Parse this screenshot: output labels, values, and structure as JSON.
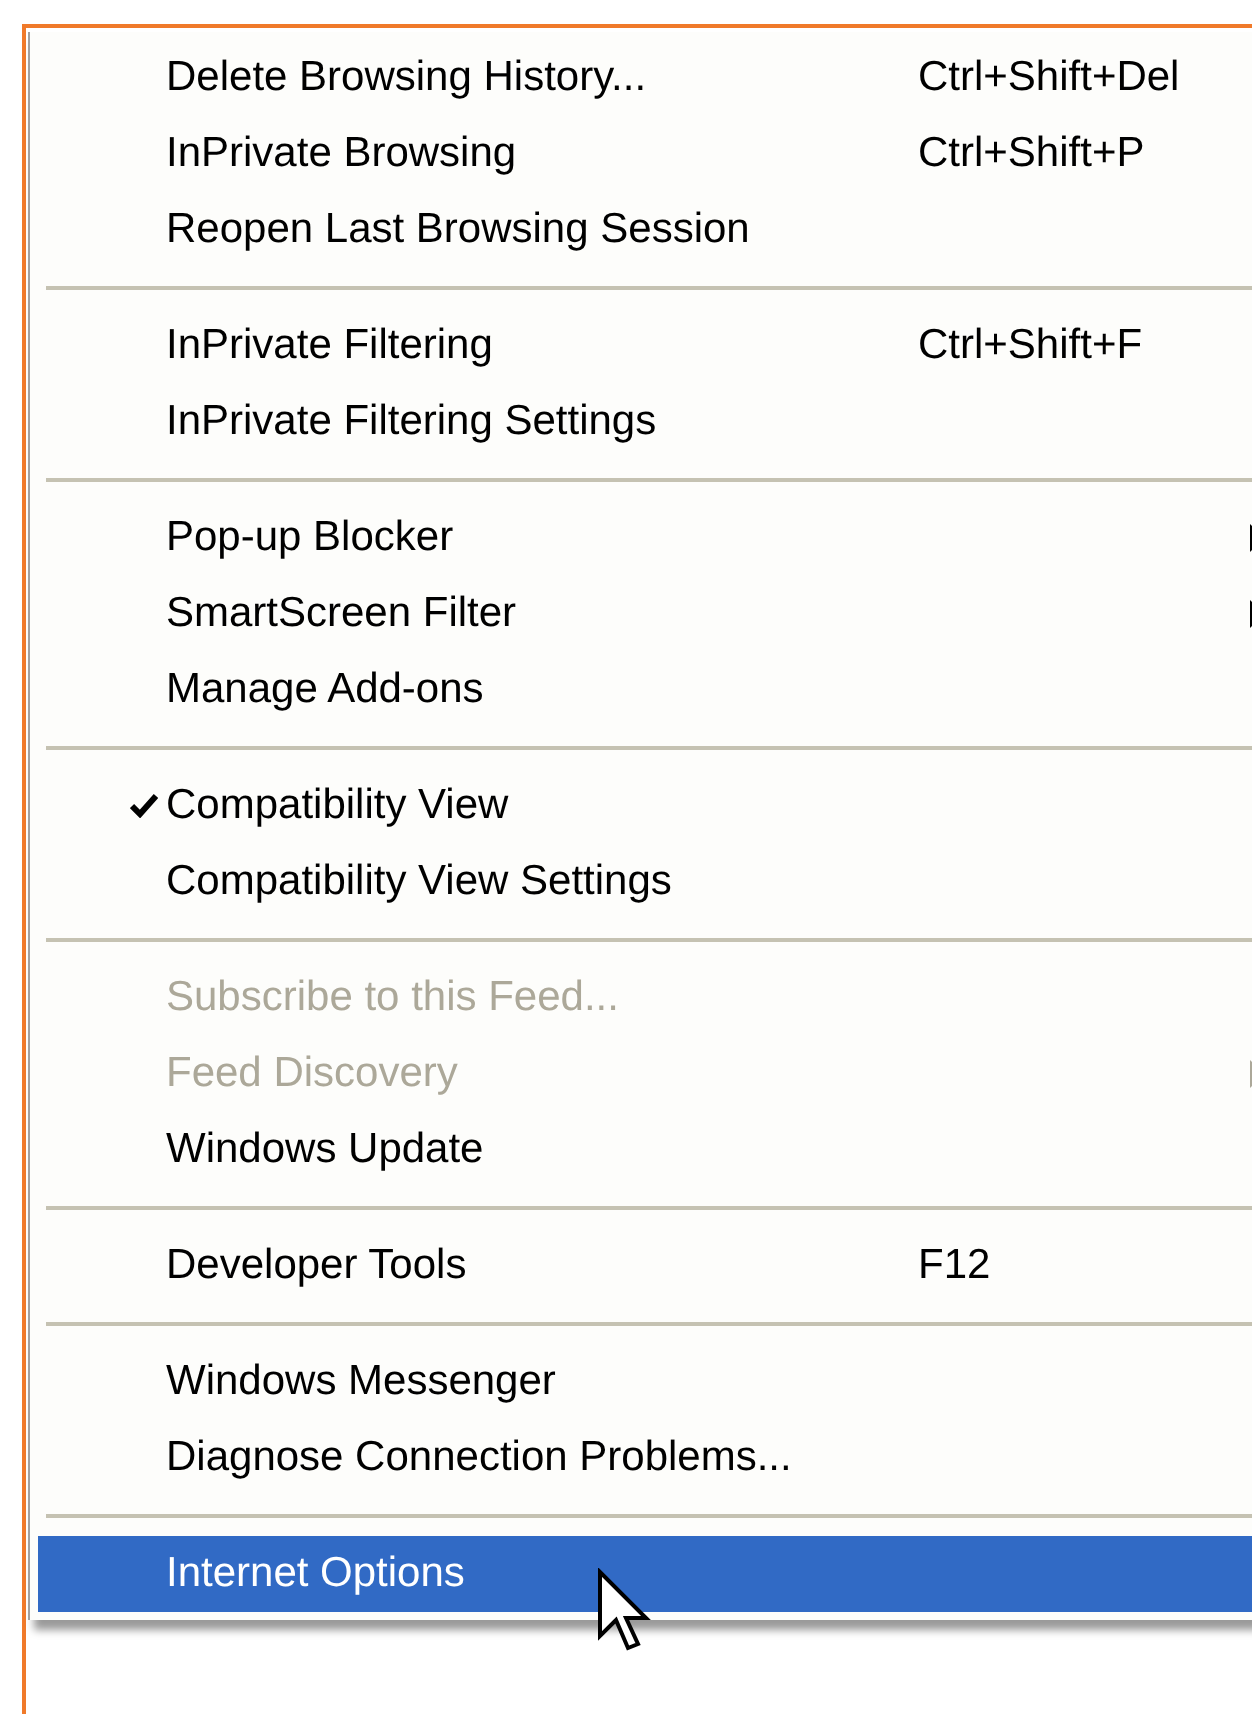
{
  "menu": {
    "groups": [
      {
        "items": [
          {
            "label": "Delete Browsing History...",
            "shortcut": "Ctrl+Shift+Del",
            "submenu": false,
            "checked": false,
            "disabled": false,
            "selected": false
          },
          {
            "label": "InPrivate Browsing",
            "shortcut": "Ctrl+Shift+P",
            "submenu": false,
            "checked": false,
            "disabled": false,
            "selected": false
          },
          {
            "label": "Reopen Last Browsing Session",
            "submenu": false,
            "checked": false,
            "disabled": false,
            "selected": false
          }
        ]
      },
      {
        "items": [
          {
            "label": "InPrivate Filtering",
            "shortcut": "Ctrl+Shift+F",
            "submenu": false,
            "checked": false,
            "disabled": false,
            "selected": false
          },
          {
            "label": "InPrivate Filtering Settings",
            "submenu": false,
            "checked": false,
            "disabled": false,
            "selected": false
          }
        ]
      },
      {
        "items": [
          {
            "label": "Pop-up Blocker",
            "submenu": true,
            "checked": false,
            "disabled": false,
            "selected": false
          },
          {
            "label": "SmartScreen Filter",
            "submenu": true,
            "checked": false,
            "disabled": false,
            "selected": false
          },
          {
            "label": "Manage Add-ons",
            "submenu": false,
            "checked": false,
            "disabled": false,
            "selected": false
          }
        ]
      },
      {
        "items": [
          {
            "label": "Compatibility View",
            "submenu": false,
            "checked": true,
            "disabled": false,
            "selected": false
          },
          {
            "label": "Compatibility View Settings",
            "submenu": false,
            "checked": false,
            "disabled": false,
            "selected": false
          }
        ]
      },
      {
        "items": [
          {
            "label": "Subscribe to this Feed...",
            "submenu": false,
            "checked": false,
            "disabled": true,
            "selected": false
          },
          {
            "label": "Feed Discovery",
            "submenu": true,
            "checked": false,
            "disabled": true,
            "selected": false
          },
          {
            "label": "Windows Update",
            "submenu": false,
            "checked": false,
            "disabled": false,
            "selected": false
          }
        ]
      },
      {
        "items": [
          {
            "label": "Developer Tools",
            "shortcut": "F12",
            "submenu": false,
            "checked": false,
            "disabled": false,
            "selected": false
          }
        ]
      },
      {
        "items": [
          {
            "label": "Windows Messenger",
            "submenu": false,
            "checked": false,
            "disabled": false,
            "selected": false
          },
          {
            "label": "Diagnose Connection Problems...",
            "submenu": false,
            "checked": false,
            "disabled": false,
            "selected": false
          }
        ]
      },
      {
        "items": [
          {
            "label": "Internet Options",
            "submenu": false,
            "checked": false,
            "disabled": false,
            "selected": true
          }
        ]
      }
    ]
  }
}
